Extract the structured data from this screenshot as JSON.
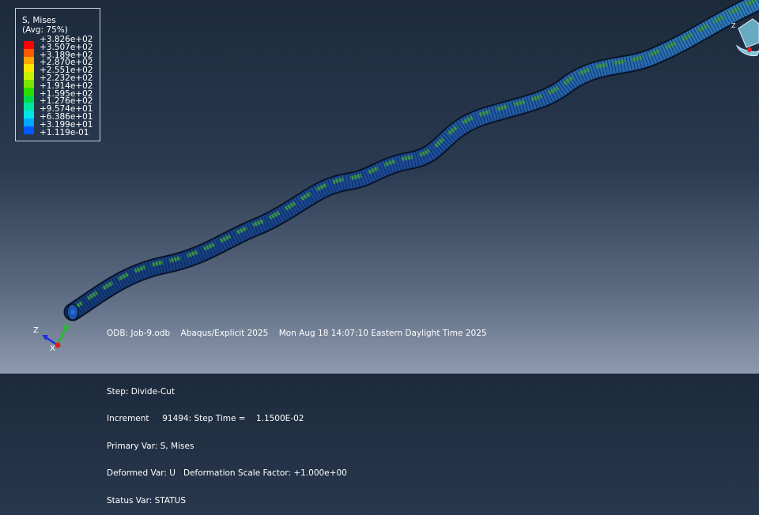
{
  "legend": {
    "title": "S, Mises",
    "subtitle": "(Avg: 75%)",
    "entries": [
      {
        "value": "+3.826e+02",
        "color": "#ff0000"
      },
      {
        "value": "+3.507e+02",
        "color": "#ff5a00"
      },
      {
        "value": "+3.189e+02",
        "color": "#ffa800"
      },
      {
        "value": "+2.870e+02",
        "color": "#ffe600"
      },
      {
        "value": "+2.551e+02",
        "color": "#c7f200"
      },
      {
        "value": "+2.232e+02",
        "color": "#7ae600"
      },
      {
        "value": "+1.914e+02",
        "color": "#2ddc00"
      },
      {
        "value": "+1.595e+02",
        "color": "#00dc46"
      },
      {
        "value": "+1.276e+02",
        "color": "#00e6a0"
      },
      {
        "value": "+9.574e+01",
        "color": "#00e6e6"
      },
      {
        "value": "+6.386e+01",
        "color": "#00a8ff"
      },
      {
        "value": "+3.199e+01",
        "color": "#005aff"
      },
      {
        "value": "+1.119e-01",
        "color": "#0000d8"
      }
    ]
  },
  "info": {
    "odb_line": "ODB: Job-9.odb    Abaqus/Explicit 2025    Mon Aug 18 14:07:10 Eastern Daylight Time 2025",
    "step": "Step: Divide-Cut",
    "increment": "Increment     91494: Step Time =    1.1500E-02",
    "primary_var": "Primary Var: S, Mises",
    "deformed_var": "Deformed Var: U   Deformation Scale Factor: +1.000e+00",
    "status_var": "Status Var: STATUS"
  },
  "triad": {
    "axis_z": "Z",
    "axis_y": "Y",
    "axis_x": "X",
    "colors": {
      "z": "#2030e0",
      "y": "#20c020",
      "x": "#e02020"
    }
  },
  "model": {
    "body_color": "#1e4a9a",
    "highlight_colors": [
      "#2e8a3a",
      "#4fa84a",
      "#3b7ad0",
      "#5aa0c8"
    ]
  }
}
